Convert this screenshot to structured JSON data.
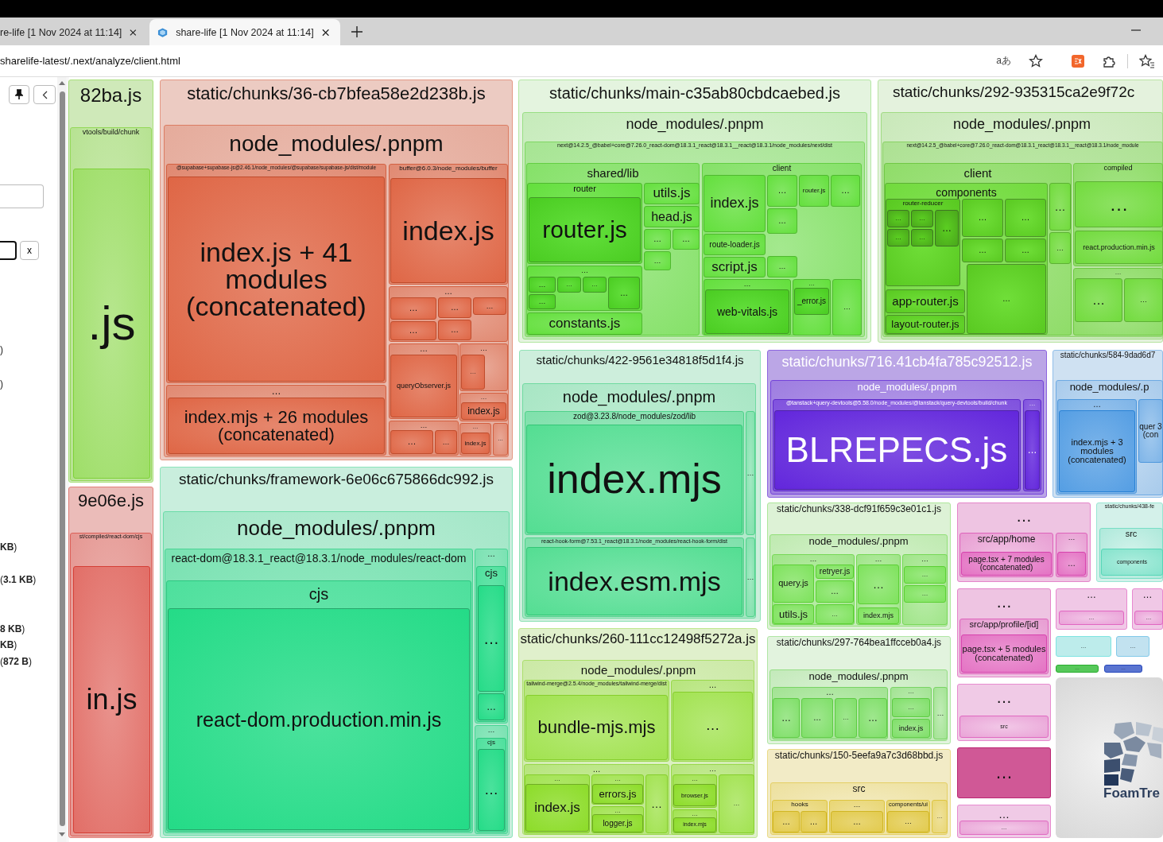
{
  "browser": {
    "tabs": [
      {
        "title": "re-life [1 Nov 2024 at 11:14]",
        "selected": false
      },
      {
        "title": "share-life [1 Nov 2024 at 11:14]",
        "selected": true
      }
    ],
    "address": "sharelife-latest/.next/analyze/client.html",
    "translate": "aあ"
  },
  "sidebar": {
    "clear_button": "x",
    "size_texts": [
      ")",
      ")",
      "**KB**)",
      "(**3.1 KB**)",
      "**8 KB**)",
      "**KB**)",
      "(**872 B**)"
    ]
  },
  "treemap": [
    {
      "label": "82ba.js",
      "color": "#cfe9b9",
      "children": [
        {
          "label": "vtools/build/chunk",
          "children": [
            {
              "label": ".js"
            }
          ]
        }
      ]
    },
    {
      "label": "9e06e.js",
      "color": "#ebbcb9",
      "children": [
        {
          "label": "st/compiled/react-dom/cjs",
          "children": [
            {
              "label": "in.js"
            }
          ]
        }
      ]
    },
    {
      "label": "static/chunks/36-cb7bfea58e2d238b.js",
      "color": "#eccbc2",
      "children": [
        {
          "label": "node_modules/.pnpm",
          "children": [
            {
              "label": "@supabase+supabase-js@2.46.1/node_modules/@supabase/supabase-js/dist/module",
              "children": [
                {
                  "label": "index.js + 41 modules (concatenated)"
                }
              ]
            },
            {
              "label": "…",
              "children": [
                {
                  "label": "index.mjs + 26 modules (concatenated)"
                }
              ]
            },
            {
              "label": "buffer@6.0.3/node_modules/buffer",
              "children": [
                {
                  "label": "index.js"
                }
              ]
            },
            {
              "label": "…",
              "children": [
                {
                  "label": "…"
                },
                {
                  "label": "…"
                },
                {
                  "label": "…"
                },
                {
                  "label": "…"
                },
                {
                  "label": "…"
                }
              ]
            },
            {
              "label": "…",
              "children": [
                {
                  "label": "queryObserver.js"
                }
              ]
            },
            {
              "label": "…",
              "children": [
                {
                  "label": "…"
                }
              ]
            },
            {
              "label": "…",
              "children": [
                {
                  "label": "index.js"
                }
              ]
            },
            {
              "label": "…",
              "children": [
                {
                  "label": "…"
                },
                {
                  "label": "…"
                }
              ]
            },
            {
              "label": "…",
              "children": [
                {
                  "label": "index.js"
                }
              ]
            },
            {
              "label": "…"
            }
          ]
        }
      ]
    },
    {
      "label": "static/chunks/framework-6e06c675866dc992.js",
      "color": "#c9eedd",
      "children": [
        {
          "label": "node_modules/.pnpm",
          "children": [
            {
              "label": "react-dom@18.3.1_react@18.3.1/node_modules/react-dom",
              "children": [
                {
                  "label": "cjs",
                  "children": [
                    {
                      "label": "react-dom.production.min.js"
                    }
                  ]
                }
              ]
            },
            {
              "label": "…",
              "children": [
                {
                  "label": "cjs",
                  "children": [
                    {
                      "label": "…"
                    },
                    {
                      "label": "…"
                    }
                  ]
                }
              ]
            },
            {
              "label": "…",
              "children": [
                {
                  "label": "cjs",
                  "children": [
                    {
                      "label": "…"
                    }
                  ]
                }
              ]
            }
          ]
        }
      ]
    },
    {
      "label": "static/chunks/main-c35ab80cbdcaebed.js",
      "color": "#e4f4df",
      "children": [
        {
          "label": "node_modules/.pnpm",
          "children": [
            {
              "label": "next@14.2.5_@babel+core@7.26.0_react-dom@18.3.1_react@18.3.1__react@18.3.1/node_modules/next/dist",
              "children": [
                {
                  "label": "shared/lib",
                  "children": [
                    {
                      "label": "router",
                      "children": [
                        {
                          "label": "router.js"
                        }
                      ]
                    },
                    {
                      "label": "…",
                      "children": [
                        {
                          "label": "…"
                        },
                        {
                          "label": "…"
                        },
                        {
                          "label": "…"
                        },
                        {
                          "label": "…"
                        },
                        {
                          "label": "…"
                        }
                      ]
                    },
                    {
                      "label": "constants.js"
                    },
                    {
                      "label": "utils.js"
                    },
                    {
                      "label": "head.js"
                    },
                    {
                      "label": "…"
                    },
                    {
                      "label": "…"
                    },
                    {
                      "label": "…"
                    }
                  ]
                },
                {
                  "label": "client",
                  "children": [
                    {
                      "label": "index.js"
                    },
                    {
                      "label": "…"
                    },
                    {
                      "label": "router.js"
                    },
                    {
                      "label": "…"
                    },
                    {
                      "label": "route-loader.js"
                    },
                    {
                      "label": "script.js"
                    },
                    {
                      "label": "…"
                    },
                    {
                      "label": "…"
                    },
                    {
                      "label": "…",
                      "children": [
                        {
                          "label": "web-vitals.js"
                        }
                      ]
                    },
                    {
                      "label": "…",
                      "children": [
                        {
                          "label": "_error.js"
                        }
                      ]
                    },
                    {
                      "label": "…"
                    }
                  ]
                }
              ]
            }
          ]
        }
      ]
    },
    {
      "label": "static/chunks/292-935315ca2e9f72c",
      "color": "#e4f2dd",
      "children": [
        {
          "label": "node_modules/.pnpm",
          "children": [
            {
              "label": "next@14.2.5_@babel+core@7.26.0_react-dom@18.3.1_react@18.3.1__react@18.3.1/node_module",
              "children": [
                {
                  "label": "client",
                  "children": [
                    {
                      "label": "components",
                      "children": [
                        {
                          "label": "router-reducer",
                          "children": [
                            {
                              "label": "…"
                            },
                            {
                              "label": "…"
                            },
                            {
                              "label": "…"
                            },
                            {
                              "label": "…"
                            },
                            {
                              "label": "…"
                            }
                          ]
                        },
                        {
                          "label": "app-router.js"
                        },
                        {
                          "label": "layout-router.js"
                        },
                        {
                          "label": "…"
                        },
                        {
                          "label": "…"
                        },
                        {
                          "label": "…"
                        },
                        {
                          "label": "…"
                        },
                        {
                          "label": "…"
                        }
                      ]
                    },
                    {
                      "label": "…"
                    },
                    {
                      "label": "…"
                    }
                  ]
                },
                {
                  "label": "compiled",
                  "children": [
                    {
                      "label": "…"
                    },
                    {
                      "label": "react.production.min.js"
                    }
                  ]
                },
                {
                  "label": "…",
                  "children": [
                    {
                      "label": "…"
                    },
                    {
                      "label": "…"
                    }
                  ]
                }
              ]
            }
          ]
        }
      ]
    },
    {
      "label": "static/chunks/422-9561e34818f5d1f4.js",
      "color": "#cdeedc",
      "children": [
        {
          "label": "node_modules/.pnpm",
          "children": [
            {
              "label": "zod@3.23.8/node_modules/zod/lib",
              "children": [
                {
                  "label": "index.mjs"
                }
              ]
            },
            {
              "label": "…"
            },
            {
              "label": "react-hook-form@7.53.1_react@18.3.1/node_modules/react-hook-form/dist",
              "children": [
                {
                  "label": "index.esm.mjs"
                }
              ]
            },
            {
              "label": "…"
            }
          ]
        }
      ]
    },
    {
      "label": "static/chunks/716.41cb4fa785c92512.js",
      "color": "#bba6e6",
      "inverse_labels": true,
      "children": [
        {
          "label": "node_modules/.pnpm",
          "children": [
            {
              "label": "@tanstack+query-devtools@5.58.0/node_modules/@tanstack/query-devtools/build/chunk",
              "children": [
                {
                  "label": "BLREPECS.js"
                }
              ]
            },
            {
              "label": "…",
              "children": [
                {
                  "label": "…"
                }
              ]
            }
          ]
        }
      ]
    },
    {
      "label": "static/chunks/584-9dad6d7",
      "color": "#cfe1f2",
      "children": [
        {
          "label": "node_modules/.p",
          "children": [
            {
              "label": "…",
              "children": [
                {
                  "label": "index.mjs + 3 modules (concatenated)"
                }
              ]
            },
            {
              "label": "quer 3 (con"
            }
          ]
        }
      ]
    },
    {
      "label": "static/chunks/338-dcf91f659c3e01c1.js",
      "color": "#ddf2d6",
      "children": [
        {
          "label": "node_modules/.pnpm",
          "children": [
            {
              "label": "…",
              "children": [
                {
                  "label": "query.js"
                },
                {
                  "label": "retryer.js"
                },
                {
                  "label": "…"
                },
                {
                  "label": "utils.js"
                },
                {
                  "label": "…"
                }
              ]
            },
            {
              "label": "…",
              "children": [
                {
                  "label": "…"
                },
                {
                  "label": "index.mjs"
                }
              ]
            },
            {
              "label": "…",
              "children": [
                {
                  "label": "…"
                },
                {
                  "label": "…"
                }
              ]
            }
          ]
        }
      ]
    },
    {
      "label": "static/chunks/297-764bea1ffcceb0a4.js",
      "color": "#e2f3de",
      "children": [
        {
          "label": "node_modules/.pnpm",
          "children": [
            {
              "label": "…",
              "children": [
                {
                  "label": "…"
                },
                {
                  "label": "…"
                },
                {
                  "label": "…"
                },
                {
                  "label": "…"
                }
              ]
            },
            {
              "label": "…",
              "children": [
                {
                  "label": "…"
                },
                {
                  "label": "index.js"
                }
              ]
            },
            {
              "label": "…"
            }
          ]
        }
      ]
    },
    {
      "label": "static/chunks/150-5eefa9a7c3d68bbd.js",
      "color": "#f2ebc6",
      "children": [
        {
          "label": "src",
          "children": [
            {
              "label": "hooks",
              "children": [
                {
                  "label": "…"
                },
                {
                  "label": "…"
                }
              ]
            },
            {
              "label": "…",
              "children": [
                {
                  "label": "…"
                }
              ]
            },
            {
              "label": "components/ui",
              "children": [
                {
                  "label": "…"
                }
              ]
            },
            {
              "label": "…"
            }
          ]
        }
      ]
    },
    {
      "label": "static/chunks/260-111cc12498f5272a.js",
      "color": "#e0f0cc",
      "children": [
        {
          "label": "node_modules/.pnpm",
          "children": [
            {
              "label": "tailwind-merge@2.5.4/node_modules/tailwind-merge/dist",
              "children": [
                {
                  "label": "bundle-mjs.mjs"
                }
              ]
            },
            {
              "label": "…",
              "children": [
                {
                  "label": "…"
                }
              ]
            },
            {
              "label": "…",
              "children": [
                {
                  "label": "…",
                  "children": [
                    {
                      "label": "index.js"
                    }
                  ]
                },
                {
                  "label": "…",
                  "children": [
                    {
                      "label": "errors.js"
                    }
                  ]
                },
                {
                  "label": "…",
                  "children": [
                    {
                      "label": "logger.js"
                    }
                  ]
                },
                {
                  "label": "…"
                }
              ]
            },
            {
              "label": "…",
              "children": [
                {
                  "label": "…",
                  "children": [
                    {
                      "label": "browser.js"
                    }
                  ]
                },
                {
                  "label": "…",
                  "children": [
                    {
                      "label": "index.mjs"
                    }
                  ]
                },
                {
                  "label": "…"
                }
              ]
            }
          ]
        }
      ]
    },
    {
      "label": "…",
      "color": "#eec4e2",
      "children": [
        {
          "label": "src/app/home",
          "children": [
            {
              "label": "page.tsx + 7 modules (concatenated)"
            }
          ]
        },
        {
          "label": "…",
          "children": [
            {
              "label": "…"
            }
          ]
        }
      ]
    },
    {
      "label": "…",
      "color": "#eec4e2",
      "children": [
        {
          "label": "src/app/profile/[id]",
          "children": [
            {
              "label": "page.tsx + 5 modules (concatenated)"
            }
          ]
        }
      ]
    },
    {
      "label": "…",
      "color": "#f0cae6",
      "children": [
        {
          "label": "src"
        }
      ]
    },
    {
      "label": "…",
      "color": "#d05896"
    },
    {
      "label": "…",
      "color": "#f0cae6",
      "children": [
        {
          "label": "…"
        }
      ]
    },
    {
      "label": "static/chunks/438-fe",
      "color": "#d4f1ea",
      "children": [
        {
          "label": "src",
          "children": [
            {
              "label": "components"
            }
          ]
        }
      ]
    },
    {
      "label": "…",
      "color": "#f0c8e6",
      "children": [
        {
          "label": "…"
        }
      ]
    },
    {
      "label": "…",
      "color": "#f0c8e6",
      "children": [
        {
          "label": "…"
        }
      ]
    },
    {
      "label": "…",
      "color": "#bdeceb"
    },
    {
      "label": "…",
      "color": "#c2e2f0"
    },
    {
      "label": "…",
      "color": "#56c85a"
    },
    {
      "label": "…",
      "color": "#5a74d0"
    }
  ],
  "branding": {
    "text": "FoamTre"
  }
}
